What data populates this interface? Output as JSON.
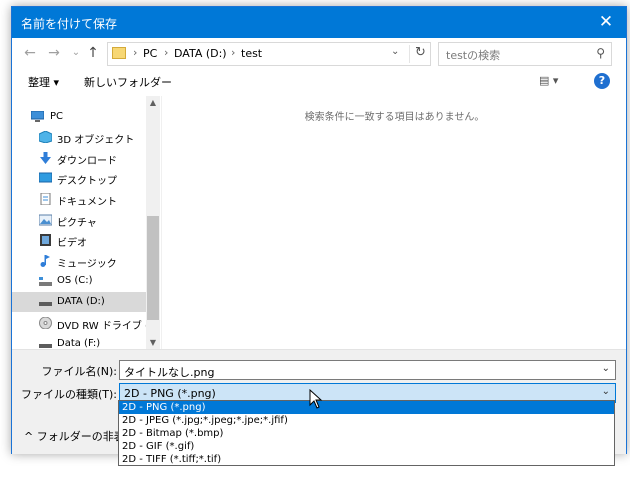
{
  "window": {
    "title": "名前を付けて保存",
    "close_symbol": "✕"
  },
  "nav": {
    "back_symbol": "←",
    "forward_symbol": "→",
    "recent_symbol": "⌄",
    "up_symbol": "↑",
    "breadcrumb": [
      "PC",
      "DATA (D:)",
      "test"
    ],
    "sep": "›",
    "dropdown_symbol": "⌄",
    "refresh_symbol": "↻",
    "search_placeholder": "testの検索",
    "search_symbol": "⚲"
  },
  "toolbar": {
    "organize_label": "整理 ▾",
    "new_folder_label": "新しいフォルダー",
    "view_symbol": "▤ ▾",
    "help_symbol": "?"
  },
  "sidebar": {
    "items": [
      {
        "label": "PC",
        "icon": "pc-icon"
      },
      {
        "label": "3D オブジェクト",
        "icon": "3d-objects-icon"
      },
      {
        "label": "ダウンロード",
        "icon": "download-icon"
      },
      {
        "label": "デスクトップ",
        "icon": "desktop-icon"
      },
      {
        "label": "ドキュメント",
        "icon": "document-icon"
      },
      {
        "label": "ピクチャ",
        "icon": "pictures-icon"
      },
      {
        "label": "ビデオ",
        "icon": "video-icon"
      },
      {
        "label": "ミュージック",
        "icon": "music-icon"
      },
      {
        "label": "OS (C:)",
        "icon": "drive-c-icon"
      },
      {
        "label": "DATA (D:)",
        "icon": "drive-d-icon",
        "selected": true
      },
      {
        "label": "DVD RW ドライブ (E:)",
        "icon": "dvd-icon"
      },
      {
        "label": "Data (F:)",
        "icon": "drive-f-icon"
      }
    ],
    "scroll_up": "▲",
    "scroll_down": "▼"
  },
  "content": {
    "empty_message": "検索条件に一致する項目はありません。"
  },
  "form": {
    "filename_label": "ファイル名(N):",
    "filename_value": "タイトルなし.png",
    "filetype_label": "ファイルの種類(T):",
    "filetype_value": "2D - PNG (*.png)",
    "chevron": "⌄",
    "hide_folders_label": "^  フォルダーの非表示"
  },
  "dropdown": {
    "options": [
      "2D - PNG (*.png)",
      "2D - JPEG (*.jpg;*.jpeg;*.jpe;*.jfif)",
      "2D - Bitmap (*.bmp)",
      "2D - GIF (*.gif)",
      "2D - TIFF (*.tiff;*.tif)"
    ],
    "selected_index": 0
  },
  "colors": {
    "accent": "#0078d7",
    "selection": "#cce4f7",
    "nav_selected": "#d9d9d9"
  }
}
